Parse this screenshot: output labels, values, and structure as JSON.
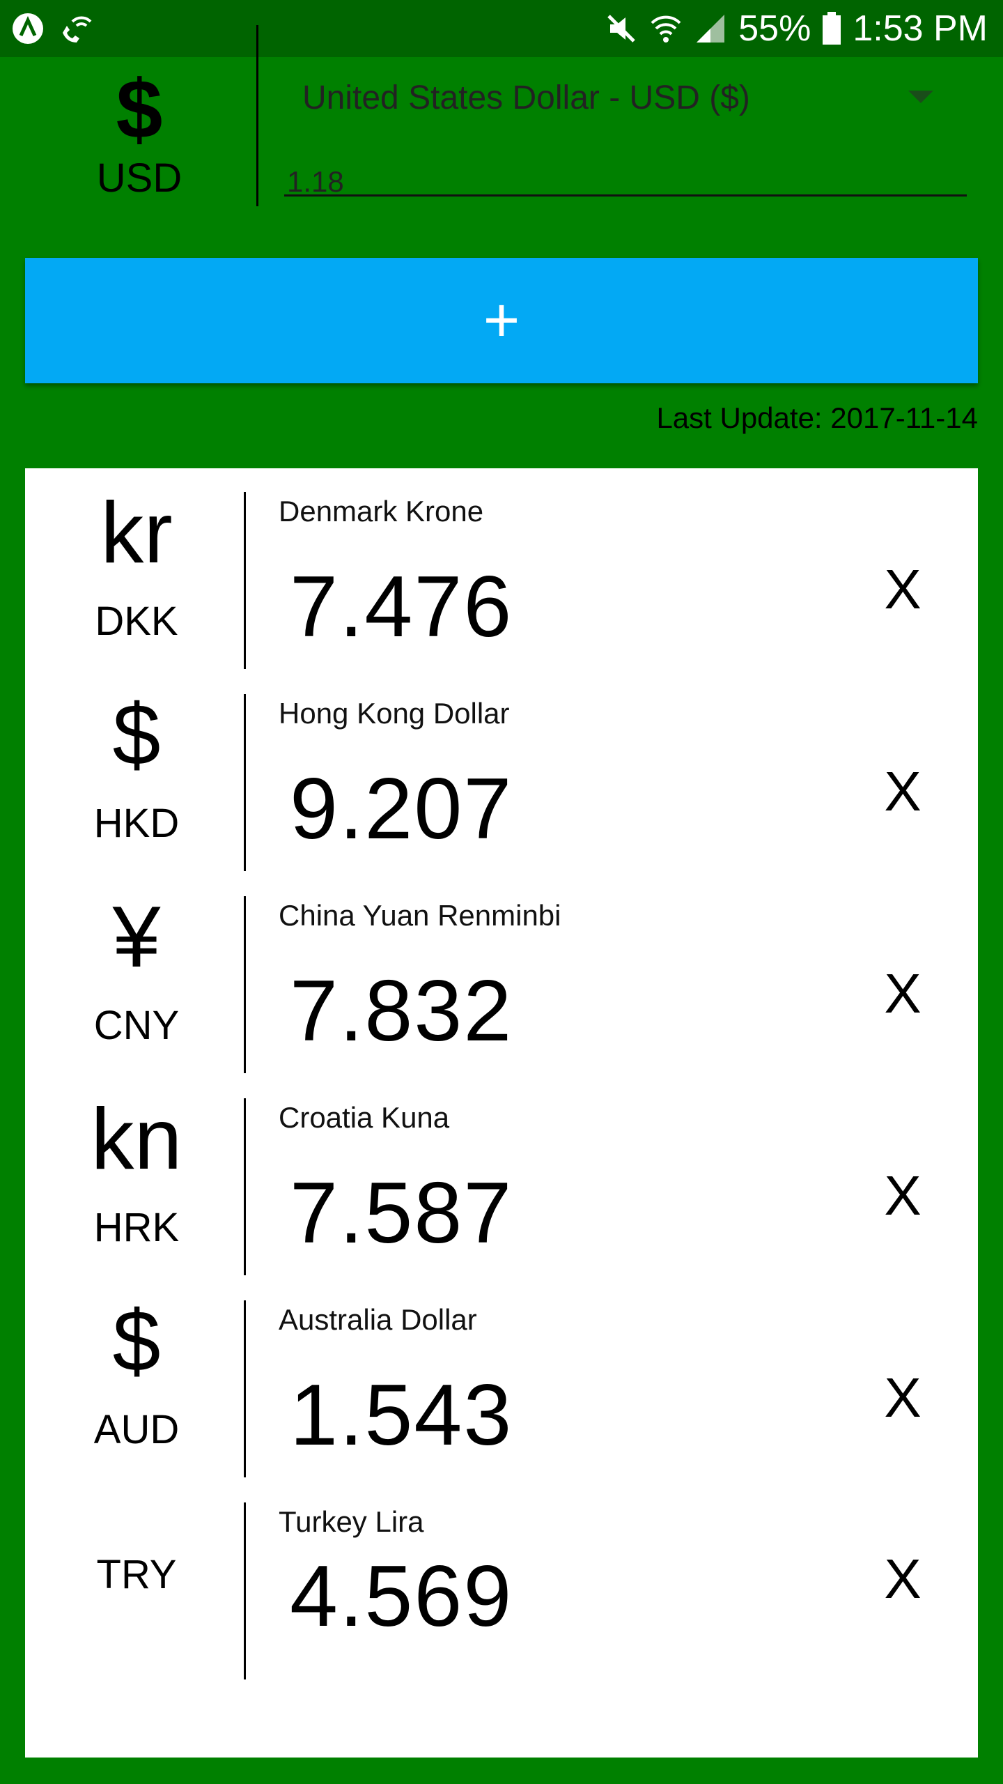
{
  "status_bar": {
    "battery": "55%",
    "time": "1:53 PM",
    "icons": [
      "app-icon",
      "wifi-call-icon",
      "mute-icon",
      "wifi-icon",
      "signal-icon",
      "battery-icon"
    ]
  },
  "base": {
    "symbol": "$",
    "code": "USD",
    "selected_currency": "United States Dollar - USD ($)",
    "amount": "1.18"
  },
  "add_button": {
    "label": "+"
  },
  "last_update": "Last Update: 2017-11-14",
  "currencies": [
    {
      "symbol": "kr",
      "code": "DKK",
      "name": "Denmark Krone",
      "rate": "7.476",
      "remove": "X"
    },
    {
      "symbol": "$",
      "code": "HKD",
      "name": "Hong Kong Dollar",
      "rate": "9.207",
      "remove": "X"
    },
    {
      "symbol": "¥",
      "code": "CNY",
      "name": "China Yuan Renminbi",
      "rate": "7.832",
      "remove": "X"
    },
    {
      "symbol": "kn",
      "code": "HRK",
      "name": "Croatia Kuna",
      "rate": "7.587",
      "remove": "X"
    },
    {
      "symbol": "$",
      "code": "AUD",
      "name": "Australia Dollar",
      "rate": "1.543",
      "remove": "X"
    },
    {
      "symbol": "",
      "code": "TRY",
      "name": "Turkey Lira",
      "rate": "4.569",
      "remove": "X"
    }
  ],
  "colors": {
    "background": "#008000",
    "status_bar": "#006400",
    "button": "#03A9F4"
  }
}
